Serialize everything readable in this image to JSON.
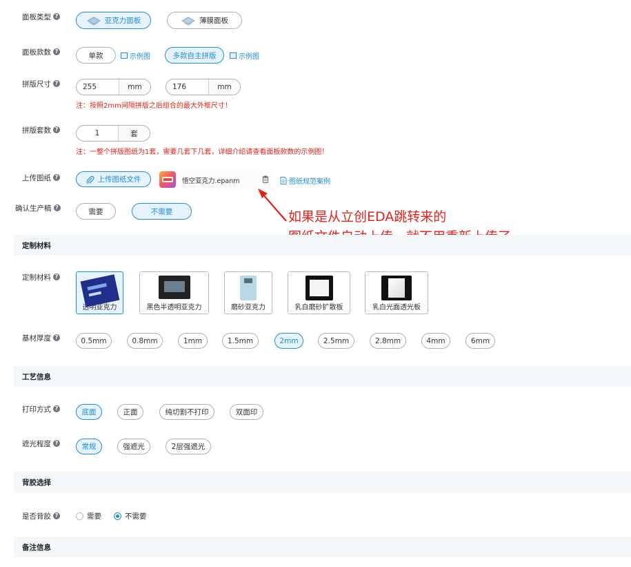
{
  "panel_type": {
    "label": "面板类型",
    "options": [
      {
        "label": "亚克力面板",
        "active": true,
        "icon": "panel-layers-icon"
      },
      {
        "label": "薄膜面板",
        "active": false,
        "icon": "panel-layers-icon"
      }
    ]
  },
  "panel_style": {
    "label": "面板款数",
    "single": "单款",
    "single_example": "示例图",
    "multi": "多款自主拼版",
    "multi_example": "示例图"
  },
  "panel_size": {
    "label": "拼版尺寸",
    "width": "255",
    "height": "176",
    "unit": "mm",
    "note": "注：按照2mm间隔拼版之后组合的最大外框尺寸！"
  },
  "panel_sets": {
    "label": "拼版套数",
    "value": "1",
    "unit": "套",
    "note": "注：一整个拼版图纸为1套，需要几套下几套，详细介绍请查看面板款数的示例图！"
  },
  "upload": {
    "label": "上传图纸",
    "button": "上传图纸文件",
    "file_name": "悟空亚克力.epanm",
    "spec_link": "图纸规范案例"
  },
  "confirm_draft": {
    "label": "确认生产稿",
    "options": [
      {
        "label": "需要",
        "active": false
      },
      {
        "label": "不需要",
        "active": true
      }
    ]
  },
  "annotation": {
    "line1": "如果是从立创EDA跳转来的",
    "line2": "图纸文件自动上传，就不用重新上传了"
  },
  "sections": {
    "material": "定制材料",
    "process": "工艺信息",
    "backing": "背胶选择",
    "remarks": "备注信息"
  },
  "material": {
    "label": "定制材料",
    "options": [
      {
        "label": "透明亚克力",
        "active": true
      },
      {
        "label": "黑色半透明亚克力",
        "active": false
      },
      {
        "label": "磨砂亚克力",
        "active": false
      },
      {
        "label": "乳白磨砂扩散板",
        "active": false
      },
      {
        "label": "乳白光面透光板",
        "active": false
      }
    ]
  },
  "thickness": {
    "label": "基材厚度",
    "options": [
      "0.5mm",
      "0.8mm",
      "1mm",
      "1.5mm",
      "2mm",
      "2.5mm",
      "2.8mm",
      "4mm",
      "6mm"
    ],
    "selected": "2mm"
  },
  "print_mode": {
    "label": "打印方式",
    "options": [
      "底面",
      "正面",
      "纯切割不打印",
      "双面印"
    ],
    "selected": "底面"
  },
  "shading": {
    "label": "遮光程度",
    "options": [
      "常规",
      "强遮光",
      "2层强遮光"
    ],
    "selected": "常规"
  },
  "backing": {
    "label": "是否背胶",
    "options": [
      "需要",
      "不需要"
    ],
    "selected": "不需要"
  },
  "colors": {
    "accent": "#1f8ed8",
    "accent_bg": "#e6f3fd",
    "note_red": "#e2231a",
    "section_bg": "#f3f7fa"
  }
}
